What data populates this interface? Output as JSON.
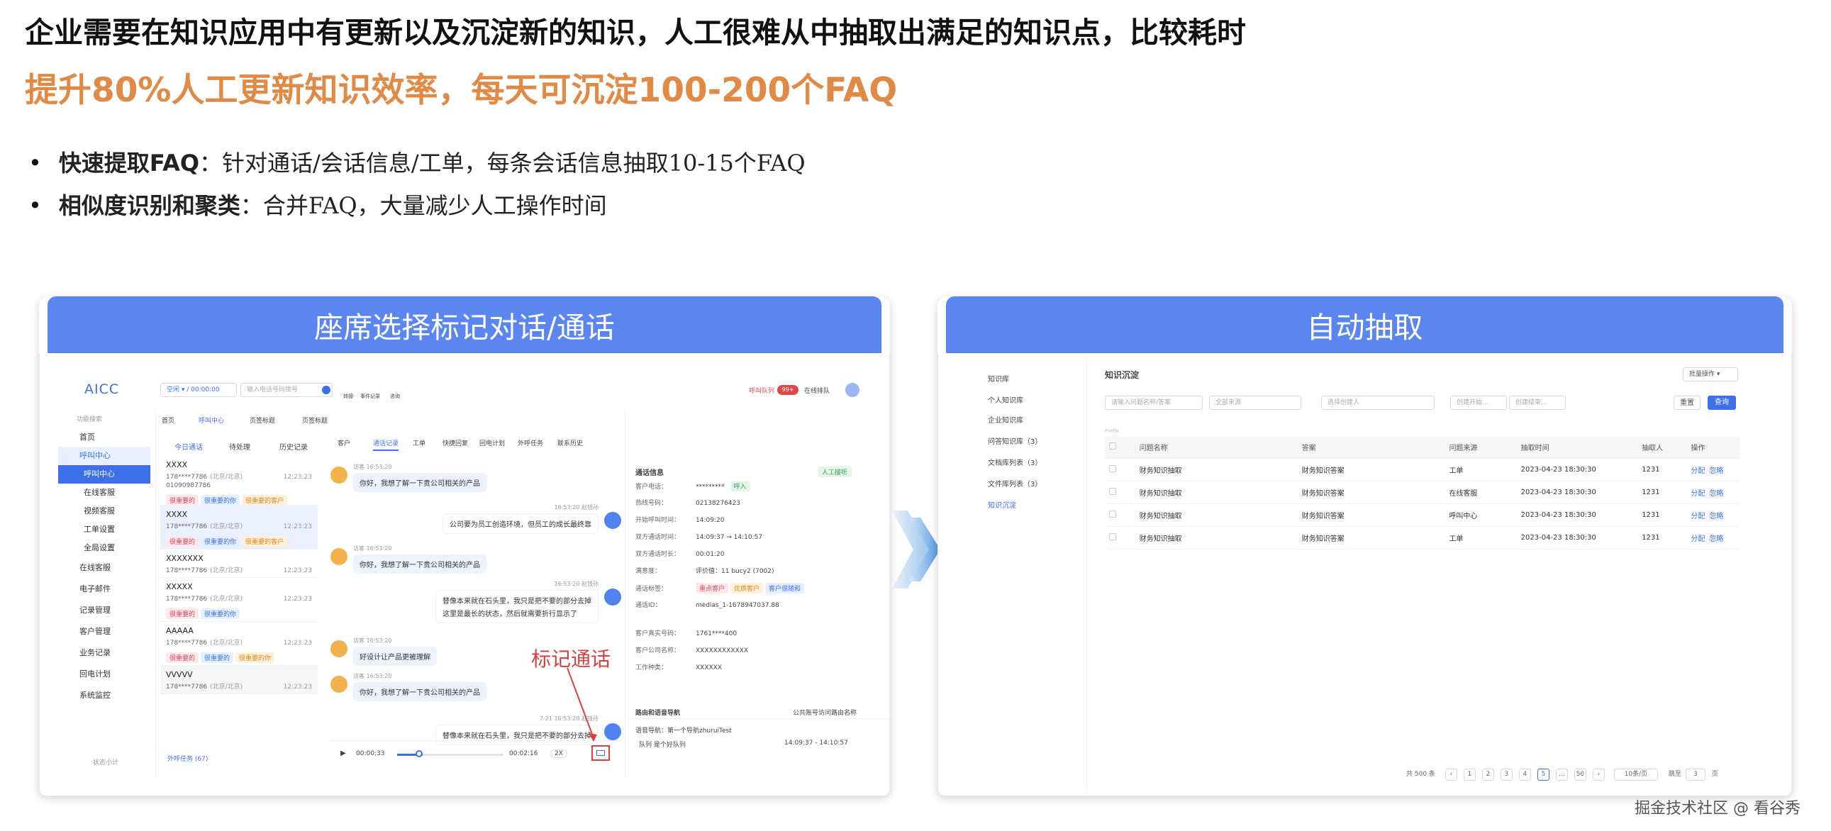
{
  "headline": "企业需要在知识应用中有更新以及沉淀新的知识，人工很难从中抽取出满足的知识点，比较耗时",
  "subheadline": "提升80%人工更新知识效率，每天可沉淀100-200个FAQ",
  "bullets": [
    {
      "title": "快速提取FAQ",
      "text": "：针对通话/会话信息/工单，每条会话信息抽取10-15个FAQ"
    },
    {
      "title": "相似度识别和聚类",
      "text": "：合并FAQ，大量减少人工操作时间"
    }
  ],
  "left_panel": {
    "title": "座席选择标记对话/通话",
    "annotation": "标记通话",
    "app": {
      "logo": "AICC",
      "status_select": "空闲",
      "timer": "00:00:00",
      "search_placeholder": "输入电话号码拨号",
      "toolbar": [
        "转接",
        "事件记录",
        "咨询"
      ],
      "queue_label": "呼叫队列",
      "queue_badge": "99+",
      "queue_state": "在线排队",
      "menu_search": "功能搜索",
      "nav": [
        "首页",
        "呼叫中心",
        "呼叫中心",
        "在线客服",
        "视频客服",
        "工单设置",
        "全局设置",
        "在线客服",
        "电子邮件",
        "记录管理",
        "客户管理",
        "业务记录",
        "回电计划",
        "系统监控"
      ],
      "nav_footer": "状态小计",
      "page_tabs": [
        "首页",
        "呼叫中心",
        "页签标题",
        "页签标题"
      ],
      "list_tabs": [
        "今日通话",
        "待处理",
        "历史记录"
      ],
      "contacts": [
        {
          "name": "XXXX",
          "phone": "178****7786",
          "loc": "(北京/北京)",
          "id": "01090987786",
          "time": "12:23:23",
          "tags": [
            "很重要的",
            "很重要的你",
            "很重要的客户"
          ]
        },
        {
          "name": "XXXX",
          "phone": "178****7786",
          "loc": "(北京/北京)",
          "id": "",
          "time": "12:23:23",
          "tags": [
            "很重要的",
            "很重要的你",
            "很重要的客户"
          ]
        },
        {
          "name": "XXXXXXX",
          "phone": "178****7786",
          "loc": "(北京/北京)",
          "id": "",
          "time": "12:23:23",
          "tags": []
        },
        {
          "name": "XXXXX",
          "phone": "178****7786",
          "loc": "(北京/北京)",
          "id": "",
          "time": "12:23:23",
          "tags": [
            "很重要的",
            "很重要的你"
          ]
        },
        {
          "name": "AAAAA",
          "phone": "178****7786",
          "loc": "(北京/北京)",
          "id": "",
          "time": "12:23:23",
          "tags": [
            "很重要的",
            "很重要的",
            "很重要的你"
          ]
        },
        {
          "name": "VVVVV",
          "phone": "178****7786",
          "loc": "(北京/北京)",
          "id": "",
          "time": "12:23:23",
          "tags": []
        }
      ],
      "list_footer": "外呼任务 (67)",
      "chat_tabs": [
        "客户",
        "通话记录",
        "工单",
        "快捷回复",
        "回电计划",
        "外呼任务",
        "联系历史"
      ],
      "messages": [
        {
          "side": "left",
          "meta": "访客 16:53:20",
          "text": "你好，我想了解一下贵公司相关的产品"
        },
        {
          "side": "right",
          "meta": "16:53:20 赵钱孙",
          "text": "公司要为员工创造环境，但员工的成长最终靠"
        },
        {
          "side": "left",
          "meta": "访客 16:53:20",
          "text": "你好，我想了解一下贵公司相关的产品"
        },
        {
          "side": "right",
          "meta": "16:53:20 赵钱孙",
          "text": "替像本来就在石头里，我只是把不要的部分去掉",
          "text2": "这里是最长的状态，然后就需要折行显示了"
        },
        {
          "side": "left",
          "meta": "访客 16:53:20",
          "text": "好设计让产品更被理解"
        },
        {
          "side": "left",
          "meta": "访客 16:53:20",
          "text": "你好，我想了解一下贵公司相关的产品"
        },
        {
          "side": "right",
          "meta": "7-21 16:53:20 赵钱孙",
          "text": "替像本来就在石头里，我只是把不要的部分去掉"
        }
      ],
      "player": {
        "current": "00:00:33",
        "total": "00:02:16",
        "speed": "2X"
      },
      "info_title": "通话信息",
      "info_badge": "人工接听",
      "info_rows": [
        {
          "label": "客户电话：",
          "value": "*********",
          "tag": "呼入"
        },
        {
          "label": "热线号码：",
          "value": "02138276423"
        },
        {
          "label": "开始呼叫时间：",
          "value": "14:09:20"
        },
        {
          "label": "双方通话时间：",
          "value": "14:09:37 → 14:10:57"
        },
        {
          "label": "双方通话时长：",
          "value": "00:01:20"
        },
        {
          "label": "满意度：",
          "value": "评价值：11    bucy2 (7002)"
        },
        {
          "label": "通话标签：",
          "tags": [
            "重点客户",
            "优质客户",
            "客户很随和"
          ]
        },
        {
          "label": "通话ID：",
          "value": "medias_1-1678947037.88"
        },
        {
          "label": "客户真实号码：",
          "value": "1761****400"
        },
        {
          "label": "客户公司名称：",
          "value": "XXXXXXXXXXXX"
        },
        {
          "label": "工作种类：",
          "value": "XXXXXX"
        }
      ],
      "route_title": "路由和语音导航",
      "route_right": "公共账号访问路由名称",
      "route_nav": "语音导航：第一个导航zhuruiTest",
      "route_queue": "队列  是个好队列",
      "route_times": "14:09:37  -  14:10:57"
    }
  },
  "right_panel": {
    "title": "自动抽取",
    "app": {
      "sidebar": [
        "知识库",
        "个人知识库",
        "企业知识库",
        "问答知识库（3）",
        "文档库列表（3）",
        "文件库列表（3）",
        "知识沉淀"
      ],
      "page_title": "知识沉淀",
      "batch_button": "批量操作",
      "filters": [
        "请输入问题名称/答案",
        "全部来源",
        "选择创建人",
        "创建开始...",
        "创建结束..."
      ],
      "reset": "重置",
      "query": "查询",
      "filter_caption": "Prefix",
      "columns": [
        "问题名称",
        "答案",
        "问题来源",
        "抽取时间",
        "抽取人",
        "操作"
      ],
      "rows": [
        [
          "财务知识抽取",
          "财务知识答案",
          "工单",
          "2023-04-23 18:30:30",
          "1231"
        ],
        [
          "财务知识抽取",
          "财务知识答案",
          "在线客服",
          "2023-04-23 18:30:30",
          "1231"
        ],
        [
          "财务知识抽取",
          "财务知识答案",
          "呼叫中心",
          "2023-04-23 18:30:30",
          "1231"
        ],
        [
          "财务知识抽取",
          "财务知识答案",
          "工单",
          "2023-04-23 18:30:30",
          "1231"
        ]
      ],
      "actions": [
        "分配",
        "忽略"
      ],
      "pagination": {
        "total": "共 500 条",
        "pages": [
          "1",
          "2",
          "3",
          "4",
          "5",
          "...",
          "50"
        ],
        "current": "5",
        "size": "10条/页",
        "goto": "跳至",
        "goto_value": "3",
        "page_unit": "页"
      }
    }
  },
  "watermark": "掘金技术社区 @ 看谷秀",
  "colors": {
    "accent": "#5b86f0",
    "orange": "#e08a45",
    "link": "#3d6fe8"
  }
}
